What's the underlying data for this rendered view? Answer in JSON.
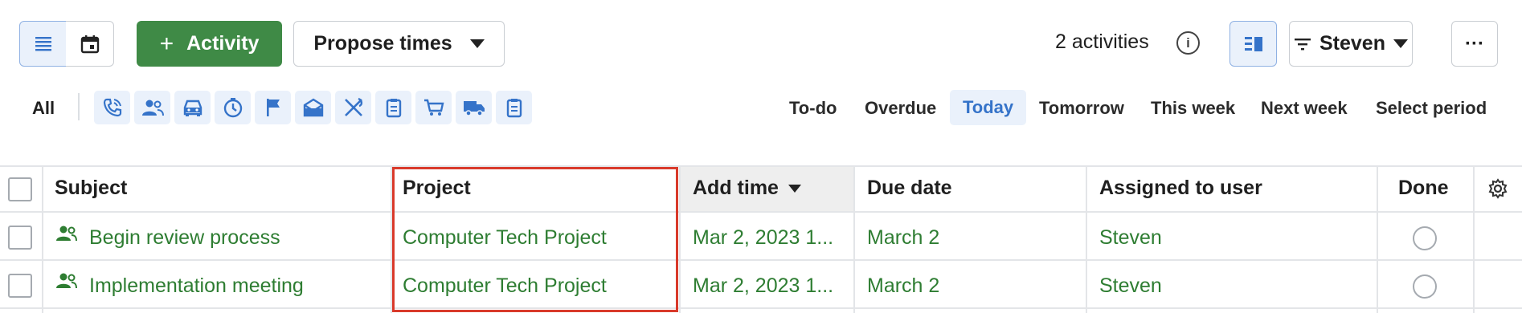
{
  "toolbar": {
    "add_activity_label": "Activity",
    "propose_times_label": "Propose times",
    "activity_count": "2 activities",
    "filter_user": "Steven",
    "more_label": "···"
  },
  "type_filter": {
    "all_label": "All",
    "icons": [
      "phone-call-icon",
      "meeting-icon",
      "car-icon",
      "deadline-icon",
      "flag-icon",
      "email-icon",
      "lunch-icon",
      "task-clipboard-icon",
      "cart-icon",
      "delivery-truck-icon",
      "clipboard-icon"
    ]
  },
  "periods": {
    "todo": "To-do",
    "overdue": "Overdue",
    "today": "Today",
    "tomorrow": "Tomorrow",
    "this_week": "This week",
    "next_week": "Next week",
    "select_period": "Select period"
  },
  "table": {
    "headers": {
      "subject": "Subject",
      "project": "Project",
      "add_time": "Add time",
      "due_date": "Due date",
      "assigned": "Assigned to user",
      "done": "Done"
    },
    "rows": [
      {
        "subject": "Begin review process",
        "project": "Computer Tech Project",
        "add_time": "Mar 2, 2023 1...",
        "due_date": "March 2",
        "assigned": "Steven"
      },
      {
        "subject": "Implementation meeting",
        "project": "Computer Tech Project",
        "add_time": "Mar 2, 2023 1...",
        "due_date": "March 2",
        "assigned": "Steven"
      }
    ]
  },
  "colors": {
    "accent_green": "#3f8a46",
    "row_text_green": "#2e7d32",
    "accent_blue": "#3573c9",
    "highlight_red": "#d93a2b"
  }
}
